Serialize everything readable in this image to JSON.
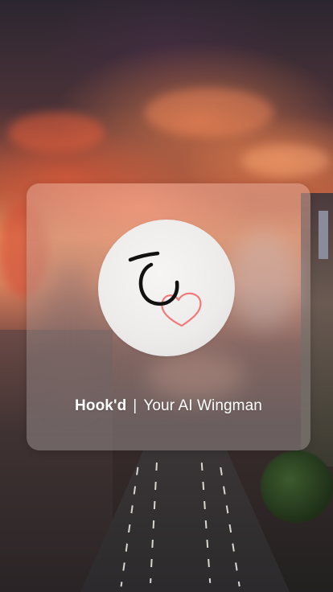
{
  "splash": {
    "brand_name": "Hook'd",
    "separator": "|",
    "tagline": "Your AI Wingman",
    "logo_icon": "hook-heart-icon"
  },
  "colors": {
    "logo_hook": "#111111",
    "logo_heart": "#f07a7a",
    "logo_circle": "#f1f0ef",
    "text": "#ffffff"
  }
}
